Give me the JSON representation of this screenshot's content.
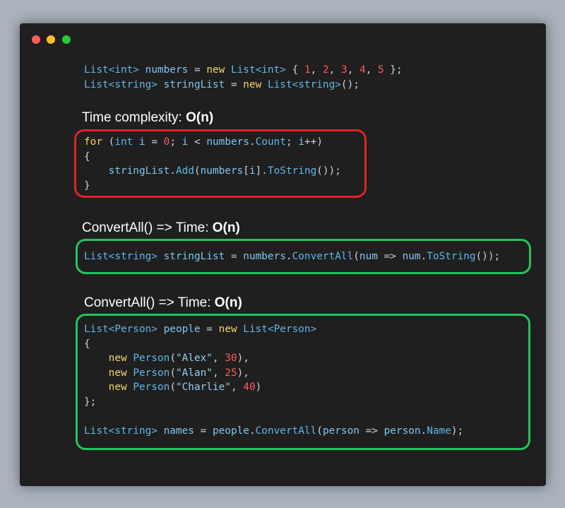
{
  "window": {
    "buttons": [
      "close",
      "minimize",
      "maximize"
    ]
  },
  "snippets": {
    "top": [
      [
        [
          "ty",
          "List<int>"
        ],
        [
          "pl",
          " "
        ],
        [
          "va",
          "numbers"
        ],
        [
          "pl",
          " = "
        ],
        [
          "kw",
          "new"
        ],
        [
          "pl",
          " "
        ],
        [
          "ty",
          "List<int>"
        ],
        [
          "pl",
          " { "
        ],
        [
          "nu",
          "1"
        ],
        [
          "pl",
          ", "
        ],
        [
          "nu",
          "2"
        ],
        [
          "pl",
          ", "
        ],
        [
          "nu",
          "3"
        ],
        [
          "pl",
          ", "
        ],
        [
          "nu",
          "4"
        ],
        [
          "pl",
          ", "
        ],
        [
          "nu",
          "5"
        ],
        [
          "pl",
          " };"
        ]
      ],
      [
        [
          "ty",
          "List<string>"
        ],
        [
          "pl",
          " "
        ],
        [
          "va",
          "stringList"
        ],
        [
          "pl",
          " = "
        ],
        [
          "kw",
          "new"
        ],
        [
          "pl",
          " "
        ],
        [
          "ty",
          "List<string>"
        ],
        [
          "pl",
          "();"
        ]
      ]
    ],
    "for_loop": [
      [
        [
          "kw",
          "for"
        ],
        [
          "pl",
          " ("
        ],
        [
          "ty",
          "int"
        ],
        [
          "pl",
          " "
        ],
        [
          "va",
          "i"
        ],
        [
          "pl",
          " = "
        ],
        [
          "nu",
          "0"
        ],
        [
          "pl",
          "; "
        ],
        [
          "va",
          "i"
        ],
        [
          "pl",
          " < "
        ],
        [
          "va",
          "numbers"
        ],
        [
          "pl",
          "."
        ],
        [
          "fn",
          "Count"
        ],
        [
          "pl",
          "; "
        ],
        [
          "va",
          "i"
        ],
        [
          "pl",
          "++)"
        ]
      ],
      [
        [
          "pl",
          "{"
        ]
      ],
      [
        [
          "pl",
          "    "
        ],
        [
          "va",
          "stringList"
        ],
        [
          "pl",
          "."
        ],
        [
          "fn",
          "Add"
        ],
        [
          "pl",
          "("
        ],
        [
          "va",
          "numbers"
        ],
        [
          "pl",
          "["
        ],
        [
          "va",
          "i"
        ],
        [
          "pl",
          "]."
        ],
        [
          "fn",
          "ToString"
        ],
        [
          "pl",
          "());"
        ]
      ],
      [
        [
          "pl",
          "}"
        ]
      ]
    ],
    "convertall_simple": [
      [
        [
          "ty",
          "List<string>"
        ],
        [
          "pl",
          " "
        ],
        [
          "va",
          "stringList"
        ],
        [
          "pl",
          " = "
        ],
        [
          "va",
          "numbers"
        ],
        [
          "pl",
          "."
        ],
        [
          "fn",
          "ConvertAll"
        ],
        [
          "pl",
          "("
        ],
        [
          "va",
          "num"
        ],
        [
          "pl",
          " => "
        ],
        [
          "va",
          "num"
        ],
        [
          "pl",
          "."
        ],
        [
          "fn",
          "ToString"
        ],
        [
          "pl",
          "());"
        ]
      ]
    ],
    "convertall_people": [
      [
        [
          "ty",
          "List<Person>"
        ],
        [
          "pl",
          " "
        ],
        [
          "va",
          "people"
        ],
        [
          "pl",
          " = "
        ],
        [
          "kw",
          "new"
        ],
        [
          "pl",
          " "
        ],
        [
          "ty",
          "List<Person>"
        ]
      ],
      [
        [
          "pl",
          "{"
        ]
      ],
      [
        [
          "pl",
          "    "
        ],
        [
          "kw",
          "new"
        ],
        [
          "pl",
          " "
        ],
        [
          "ty",
          "Person"
        ],
        [
          "pl",
          "("
        ],
        [
          "st",
          "\"Alex\""
        ],
        [
          "pl",
          ", "
        ],
        [
          "nu",
          "30"
        ],
        [
          "pl",
          "),"
        ]
      ],
      [
        [
          "pl",
          "    "
        ],
        [
          "kw",
          "new"
        ],
        [
          "pl",
          " "
        ],
        [
          "ty",
          "Person"
        ],
        [
          "pl",
          "("
        ],
        [
          "st",
          "\"Alan\""
        ],
        [
          "pl",
          ", "
        ],
        [
          "nu",
          "25"
        ],
        [
          "pl",
          "),"
        ]
      ],
      [
        [
          "pl",
          "    "
        ],
        [
          "kw",
          "new"
        ],
        [
          "pl",
          " "
        ],
        [
          "ty",
          "Person"
        ],
        [
          "pl",
          "("
        ],
        [
          "st",
          "\"Charlie\""
        ],
        [
          "pl",
          ", "
        ],
        [
          "nu",
          "40"
        ],
        [
          "pl",
          ")"
        ]
      ],
      [
        [
          "pl",
          "};"
        ]
      ],
      [
        [
          "pl",
          ""
        ]
      ],
      [
        [
          "ty",
          "List<string>"
        ],
        [
          "pl",
          " "
        ],
        [
          "va",
          "names"
        ],
        [
          "pl",
          " = "
        ],
        [
          "va",
          "people"
        ],
        [
          "pl",
          "."
        ],
        [
          "fn",
          "ConvertAll"
        ],
        [
          "pl",
          "("
        ],
        [
          "va",
          "person"
        ],
        [
          "pl",
          " => "
        ],
        [
          "va",
          "person"
        ],
        [
          "pl",
          "."
        ],
        [
          "fn",
          "Name"
        ],
        [
          "pl",
          ");"
        ]
      ]
    ]
  },
  "headings": {
    "h1": {
      "label": "Time complexity: ",
      "value": "O(n)"
    },
    "h2": {
      "label": "ConvertAll() => Time: ",
      "value": "O(n)"
    },
    "h3": {
      "label": "ConvertAll() => Time: ",
      "value": "O(n)"
    }
  },
  "colors": {
    "background": "#aab2bd",
    "window": "#1f1f1f",
    "red_box": "#e0222b",
    "green_box": "#22c55e"
  }
}
